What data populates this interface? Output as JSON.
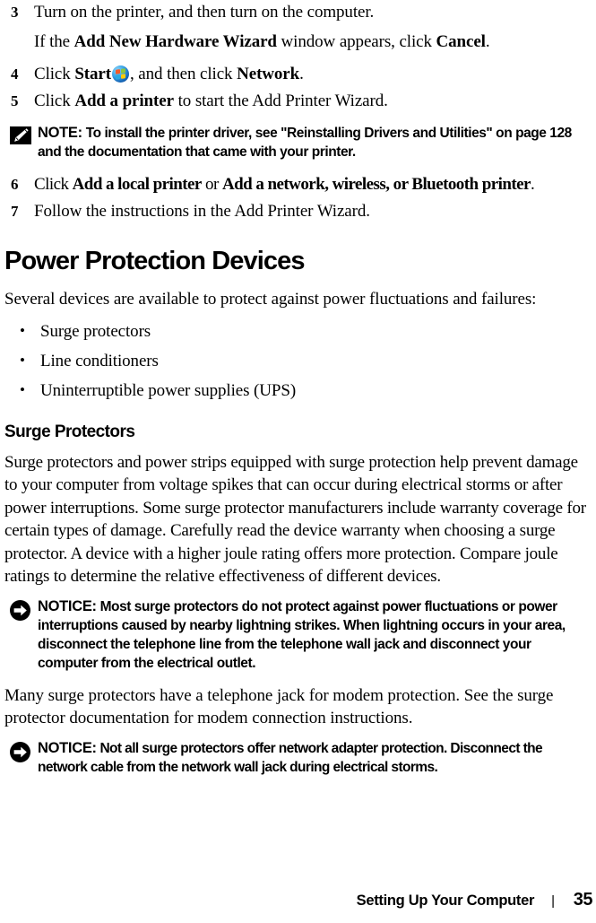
{
  "document": {
    "section_title": "Power Protection Devices",
    "subsection_title": "Surge Protectors"
  },
  "steps": [
    {
      "number": "3",
      "text_before": "Turn on the printer, and then turn on the computer.",
      "sub_before": "If the ",
      "sub_bold": "Add New Hardware Wizard",
      "sub_middle": " window appears, click ",
      "sub_bold2": "Cancel",
      "sub_after": "."
    },
    {
      "number": "4",
      "lead": "Click ",
      "bold1": "Start",
      "icon": "windows-start-orb-icon",
      "middle": ", and then click ",
      "bold2": "Network",
      "after": "."
    },
    {
      "number": "5",
      "lead": "Click ",
      "bold1": "Add a printer",
      "after": " to start the Add Printer Wizard."
    },
    {
      "number": "6",
      "lead": "Click ",
      "bold1": "Add a local printer",
      "middle": " or ",
      "bold2": "Add a network, wireless, or Bluetooth printer",
      "after": "."
    },
    {
      "number": "7",
      "lead": "Follow the instructions in the Add Printer Wizard."
    }
  ],
  "note": {
    "icon": "note-pencil-icon",
    "label": "NOTE:",
    "text": " To install the printer driver, see \"Reinstalling Drivers and Utilities\" on page 128 and the documentation that came with your printer."
  },
  "intro_paragraph": "Several devices are available to protect against power fluctuations and failures:",
  "bullets": [
    "Surge protectors",
    "Line conditioners",
    "Uninterruptible power supplies (UPS)"
  ],
  "surge_paragraph": "Surge protectors and power strips equipped with surge protection help prevent damage to your computer from voltage spikes that can occur during electrical storms or after power interruptions. Some surge protector manufacturers include warranty coverage for certain types of damage. Carefully read the device warranty when choosing a surge protector. A device with a higher joule rating offers more protection. Compare joule ratings to determine the relative effectiveness of different devices.",
  "notice_1": {
    "icon": "notice-arrow-icon",
    "label": "NOTICE:",
    "text": " Most surge protectors do not protect against power fluctuations or power interruptions caused by nearby lightning strikes. When lightning occurs in your area, disconnect the telephone line from the telephone wall jack and disconnect your computer from the electrical outlet."
  },
  "modem_paragraph": "Many surge protectors have a telephone jack for modem protection. See the surge protector documentation for modem connection instructions.",
  "notice_2": {
    "icon": "notice-arrow-icon",
    "label": "NOTICE:",
    "text": " Not all surge protectors offer network adapter protection. Disconnect the network cable from the network wall jack during electrical storms."
  },
  "footer": {
    "title": "Setting Up Your Computer",
    "separator": "|",
    "page_number": "35"
  },
  "colors": {
    "text": "#000000",
    "background": "#ffffff",
    "icon_black": "#000000"
  }
}
